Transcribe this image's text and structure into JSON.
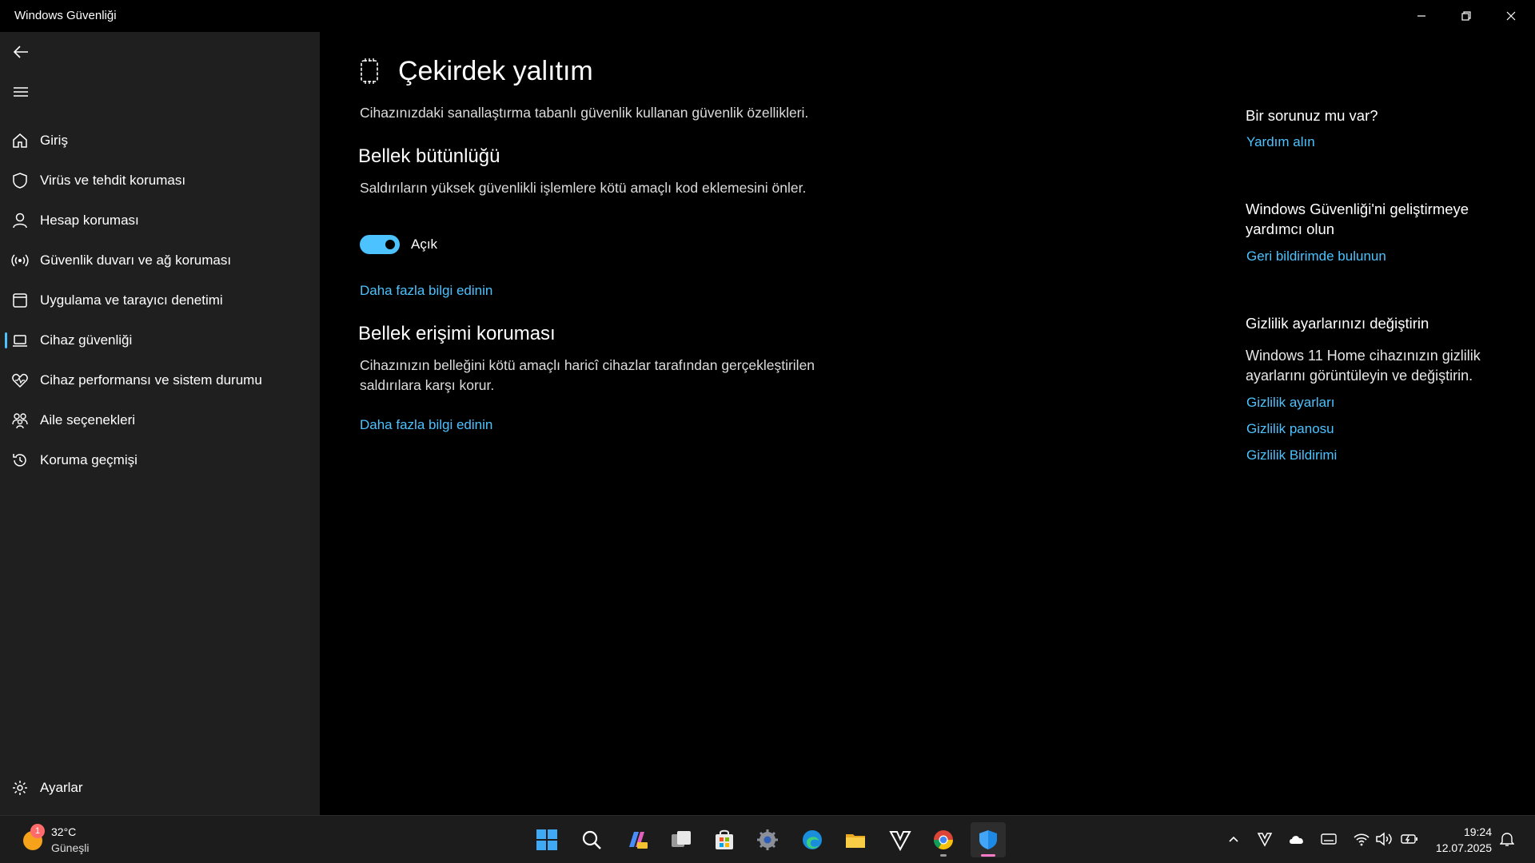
{
  "window": {
    "title": "Windows Güvenliği"
  },
  "sidebar": {
    "items": [
      {
        "label": "Giriş",
        "icon": "home-icon"
      },
      {
        "label": "Virüs ve tehdit koruması",
        "icon": "shield-icon"
      },
      {
        "label": "Hesap koruması",
        "icon": "person-icon"
      },
      {
        "label": "Güvenlik duvarı ve ağ koruması",
        "icon": "broadcast-icon"
      },
      {
        "label": "Uygulama ve tarayıcı denetimi",
        "icon": "browser-window-icon"
      },
      {
        "label": "Cihaz güvenliği",
        "icon": "laptop-icon",
        "active": true
      },
      {
        "label": "Cihaz performansı ve sistem durumu",
        "icon": "heart-pulse-icon"
      },
      {
        "label": "Aile seçenekleri",
        "icon": "family-icon"
      },
      {
        "label": "Koruma geçmişi",
        "icon": "history-icon"
      }
    ],
    "settings_label": "Ayarlar"
  },
  "main": {
    "title": "Çekirdek yalıtım",
    "description": "Cihazınızdaki sanallaştırma tabanlı güvenlik kullanan güvenlik özellikleri.",
    "memory_integrity": {
      "heading": "Bellek bütünlüğü",
      "description": "Saldırıların yüksek güvenlikli işlemlere kötü amaçlı kod eklemesini önler.",
      "toggle_state": "Açık",
      "toggle_on": true,
      "link": "Daha fazla bilgi edinin"
    },
    "memory_access": {
      "heading": "Bellek erişimi koruması",
      "description_line1": "Cihazınızın belleğini kötü amaçlı haricî cihazlar tarafından gerçekleştirilen",
      "description_line2": "saldırılara karşı korur.",
      "link": "Daha fazla bilgi edinin"
    }
  },
  "right_panel": {
    "help": {
      "heading": "Bir sorunuz mu var?",
      "link": "Yardım alın"
    },
    "feedback": {
      "heading_line1": "Windows Güvenliği'ni geliştirmeye",
      "heading_line2": "yardımcı olun",
      "link": "Geri bildirimde bulunun"
    },
    "privacy": {
      "heading": "Gizlilik ayarlarınızı değiştirin",
      "text_line1": "Windows 11 Home cihazınızın gizlilik",
      "text_line2": "ayarlarını görüntüleyin ve değiştirin.",
      "links": [
        "Gizlilik ayarları",
        "Gizlilik panosu",
        "Gizlilik Bildirimi"
      ]
    }
  },
  "taskbar": {
    "weather": {
      "badge": "1",
      "temp": "32°C",
      "condition": "Güneşli"
    },
    "clock": {
      "time": "19:24",
      "date": "12.07.2025"
    }
  },
  "colors": {
    "accent": "#4cc2ff",
    "sidebar_bg": "#1f1f1f",
    "main_bg": "#000000",
    "taskbar_bg": "#1c1c1c"
  }
}
